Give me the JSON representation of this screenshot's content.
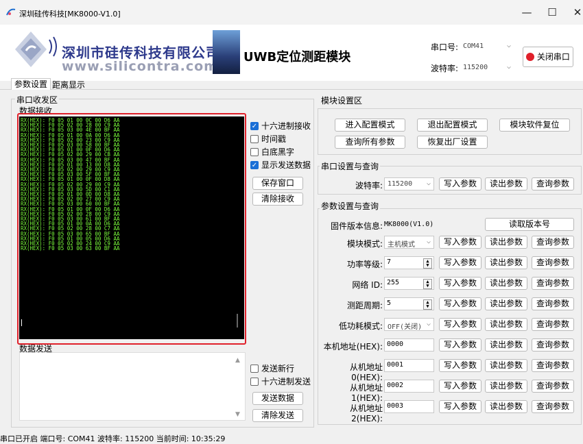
{
  "window": {
    "title": "深圳硅传科技[MK8000-V1.0]",
    "minimize": "—",
    "maximize": "☐",
    "close": "✕"
  },
  "header": {
    "company_name": "深圳市硅传科技有限公司",
    "company_url": "www.silicontra.com",
    "banner_title": "UWB定位测距模块",
    "port_label": "串口号:",
    "port_value": "COM41",
    "baud_label": "波特率:",
    "baud_value": "115200",
    "close_port_button": "关闭串口"
  },
  "tabs": [
    {
      "label": "参数设置"
    },
    {
      "label": "距离显示"
    }
  ],
  "serial": {
    "group_title": "串口收发区",
    "receive_title": "数据接收",
    "rx_lines": [
      "RX(HEX): F0 05 01 00 0C 00 D6 AA",
      "RX(HEX): F0 05 02 00 28 00 C9 AA",
      "RX(HEX): F0 05 03 00 4E 00 BF AA",
      "RX(HEX): F0 05 01 00 0A 00 D6 AA",
      "RX(HEX): F0 05 02 00 23 00 C9 AA",
      "RX(HEX): F0 05 03 00 58 00 BF AA",
      "RX(HEX): F0 05 01 00 0F 00 D6 AA",
      "RX(HEX): F0 05 02 00 29 00 CB AA",
      "RX(HEX): F0 05 03 00 47 00 BF AA",
      "RX(HEX): F0 05 01 00 13 00 D8 AA",
      "RX(HEX): F0 05 02 00 29 00 C9 AA",
      "RX(HEX): F0 05 03 00 5F 00 BF AA",
      "RX(HEX): F0 05 01 00 0F 00 D8 AA",
      "RX(HEX): F0 05 02 00 29 00 C9 AA",
      "RX(HEX): F0 05 03 00 5D 00 C1 AA",
      "RX(HEX): F0 05 01 00 0D 00 D8 AA",
      "RX(HEX): F0 05 02 00 27 00 C9 AA",
      "RX(HEX): F0 05 03 00 60 00 BF AA",
      "RX(HEX): F0 05 01 00 0F 00 D6 AA",
      "RX(HEX): F0 05 02 00 28 00 C9 AA",
      "RX(HEX): F0 05 03 00 61 00 BF AA",
      "RX(HEX): F0 05 01 00 0A 00 D6 AA",
      "RX(HEX): F0 05 02 00 28 00 C7 AA",
      "RX(HEX): F0 05 03 00 65 00 BF AA",
      "RX(HEX): F0 05 01 00 05 00 D6 AA",
      "RX(HEX): F0 05 02 00 24 00 C9 AA",
      "RX(HEX): F0 05 03 00 63 00 BF AA"
    ],
    "options": [
      {
        "label": "十六进制接收",
        "checked": true
      },
      {
        "label": "时间戳",
        "checked": false
      },
      {
        "label": "白底黑字",
        "checked": false
      },
      {
        "label": "显示发送数据",
        "checked": true
      }
    ],
    "save_window": "保存窗口",
    "clear_receive": "清除接收",
    "send_title": "数据发送",
    "send_options": [
      {
        "label": "发送新行",
        "checked": false
      },
      {
        "label": "十六进制发送",
        "checked": false
      }
    ],
    "send_button": "发送数据",
    "clear_send": "清除发送"
  },
  "module": {
    "group_title": "模块设置区",
    "enter_config": "进入配置模式",
    "exit_config": "退出配置模式",
    "soft_reset": "模块软件复位",
    "query_all": "查询所有参数",
    "factory_reset": "恢复出厂设置"
  },
  "serial_config": {
    "group_title": "串口设置与查询",
    "baud_label": "波特率:",
    "baud_value": "115200",
    "write": "写入参数",
    "read": "读出参数",
    "query": "查询参数"
  },
  "params": {
    "group_title": "参数设置与查询",
    "firmware_label": "固件版本信息:",
    "firmware_value": "MK8000(V1.0)",
    "read_version": "读取版本号",
    "write": "写入参数",
    "read": "读出参数",
    "query": "查询参数",
    "rows": [
      {
        "label": "模块模式:",
        "value": "主机模式",
        "kind": "combo"
      },
      {
        "label": "功率等级:",
        "value": "7",
        "kind": "spin"
      },
      {
        "label": "网络 ID:",
        "value": "255",
        "kind": "spin"
      },
      {
        "label": "测距周期:",
        "value": "5",
        "kind": "spin"
      },
      {
        "label": "低功耗模式:",
        "value": "OFF(关闭)",
        "kind": "combo"
      },
      {
        "label": "本机地址(HEX):",
        "value": "0000",
        "kind": "text"
      },
      {
        "label": "从机地址0(HEX):",
        "value": "0001",
        "kind": "text"
      },
      {
        "label": "从机地址1(HEX):",
        "value": "0002",
        "kind": "text"
      },
      {
        "label": "从机地址2(HEX):",
        "value": "0003",
        "kind": "text"
      }
    ]
  },
  "status": {
    "text": "串口已开启  端口号: COM41  波特率: 115200  当前时间: 10:35:29"
  },
  "colors": {
    "highlight": "#e0202a",
    "rx_text": "#7cff3c",
    "checkbox_on": "#1a6fd6"
  }
}
